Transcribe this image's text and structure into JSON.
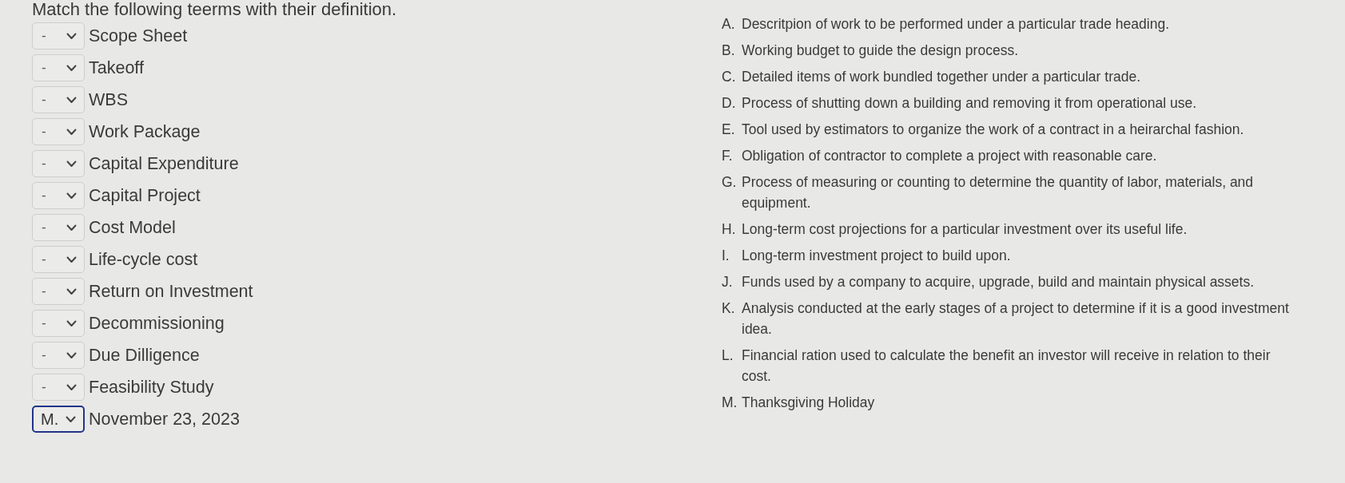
{
  "instruction": "Match the following teerms with their definition.",
  "terms": [
    {
      "answer": "-",
      "term": "Scope Sheet",
      "focused": false
    },
    {
      "answer": "-",
      "term": "Takeoff",
      "focused": false
    },
    {
      "answer": "-",
      "term": "WBS",
      "focused": false
    },
    {
      "answer": "-",
      "term": "Work Package",
      "focused": false
    },
    {
      "answer": "-",
      "term": "Capital Expenditure",
      "focused": false
    },
    {
      "answer": "-",
      "term": "Capital Project",
      "focused": false
    },
    {
      "answer": "-",
      "term": "Cost Model",
      "focused": false
    },
    {
      "answer": "-",
      "term": "Life-cycle cost",
      "focused": false
    },
    {
      "answer": "-",
      "term": "Return on Investment",
      "focused": false
    },
    {
      "answer": "-",
      "term": "Decommissioning",
      "focused": false
    },
    {
      "answer": "-",
      "term": "Due Dilligence",
      "focused": false
    },
    {
      "answer": "-",
      "term": "Feasibility Study",
      "focused": false
    },
    {
      "answer": "M.",
      "term": "November 23, 2023",
      "focused": true
    }
  ],
  "definitions": [
    {
      "letter": "A.",
      "text": "Descritpion of work to be performed under a particular trade heading."
    },
    {
      "letter": "B.",
      "text": "Working budget to guide the design process."
    },
    {
      "letter": "C.",
      "text": "Detailed items of work bundled together under a particular trade."
    },
    {
      "letter": "D.",
      "text": "Process of shutting down a building and removing it from operational use."
    },
    {
      "letter": "E.",
      "text": "Tool used by estimators to organize the work of a contract in a heirarchal fashion."
    },
    {
      "letter": "F.",
      "text": "Obligation of contractor to complete a project with reasonable care."
    },
    {
      "letter": "G.",
      "text": "Process of measuring or counting to determine the quantity of labor, materials, and equipment."
    },
    {
      "letter": "H.",
      "text": "Long-term cost projections for a particular investment over its useful life."
    },
    {
      "letter": "I.",
      "text": "Long-term investment project to build upon."
    },
    {
      "letter": "J.",
      "text": "Funds used by a company to acquire, upgrade, build and maintain physical assets."
    },
    {
      "letter": "K.",
      "text": "Analysis conducted at the early stages of a project to determine if it is a good investment idea."
    },
    {
      "letter": "L.",
      "text": "Financial ration used to calculate the benefit an investor will receive in relation to their cost."
    },
    {
      "letter": "M.",
      "text": "Thanksgiving Holiday"
    }
  ]
}
